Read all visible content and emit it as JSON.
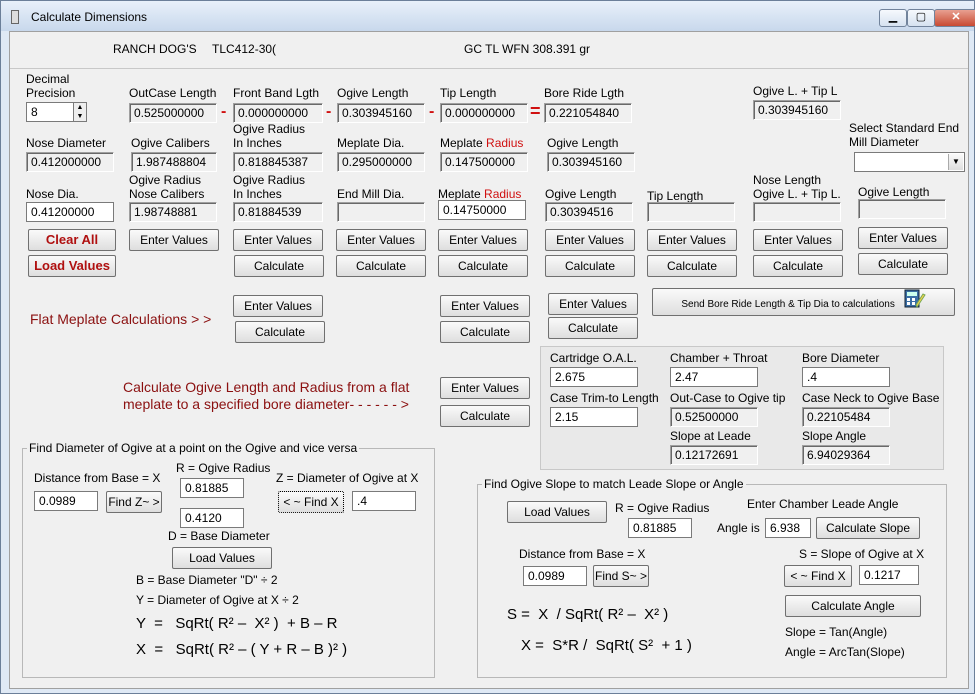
{
  "window": {
    "title": "Calculate Dimensions",
    "min": "▁",
    "max": "▢",
    "close": "✕"
  },
  "header": {
    "cartridge": "RANCH DOG'S",
    "bullet": "TLC412-30(",
    "weight": "GC TL WFN  308.391 gr"
  },
  "precision": {
    "label1": "Decimal",
    "label2": "Precision",
    "value": "8"
  },
  "row1": {
    "outcase_label": "OutCase Length",
    "outcase_value": "0.525000000",
    "frontband_label": "Front Band Lgth",
    "frontband_value": "0.000000000",
    "ogive_label": "Ogive Length",
    "ogive_value": "0.303945160",
    "tip_label": "Tip Length",
    "tip_value": "0.000000000",
    "boreride_label": "Bore Ride Lgth",
    "boreride_value": "0.221054840",
    "ogivetip_label": "Ogive L. + Tip L",
    "ogivetip_value": "0.303945160",
    "minus": "-",
    "equals": "="
  },
  "row2": {
    "nose_label": "Nose Diameter",
    "nose_value": "0.412000000",
    "calibers_label": "Ogive Calibers",
    "calibers_value": "1.987488804",
    "radius_label1": "Ogive Radius",
    "radius_label2": "In Inches",
    "radius_value": "0.818845387",
    "meplate_label": "Meplate Dia.",
    "meplate_value": "0.295000000",
    "mepradius_label": "Meplate",
    "mepradius_red": "Radius",
    "mepradius_value": "0.147500000",
    "ogivelen_label": "Ogive Length",
    "ogivelen_value": "0.303945160",
    "endmill_label1": "Select Standard End",
    "endmill_label2": "Mill Diameter"
  },
  "row3": {
    "nosedia_label": "Nose Dia.",
    "nosedia_value": "0.41200000",
    "nosecal_label1": "Ogive Radius",
    "nosecal_label2": "Nose Calibers",
    "nosecal_value": "1.98748881",
    "radin_label1": "Ogive Radius",
    "radin_label2": "In Inches",
    "radin_value": "0.81884539",
    "endmill_label": "End Mill Dia.",
    "endmill_value": "",
    "mepradius_label": "Meplate",
    "mepradius_red": "Radius",
    "mepradius_value": "0.14750000",
    "ogivelen_label": "Ogive Length",
    "ogivelen_value": "0.30394516",
    "tiplen_label": "Tip Length",
    "tiplen_value": "",
    "nosetip_label1": "Nose Length",
    "nosetip_label2": "Ogive L. + Tip L.",
    "nosetip_value": "",
    "ogivelen2_label": "Ogive Length",
    "ogivelen2_value": ""
  },
  "buttons": {
    "clear_all": "Clear All",
    "load_values": "Load Values",
    "enter_values": "Enter Values",
    "calculate": "Calculate",
    "send": "Send Bore Ride Length & Tip Dia to calculations"
  },
  "flat": {
    "text": "Flat Meplate Calculations > >"
  },
  "ogive_calc": {
    "line1": "Calculate Ogive Length and Radius from  a flat",
    "line2": "meplate to a specified  bore diameter- - - - - - >"
  },
  "cartridge_panel": {
    "oal_label": "Cartridge O.A.L.",
    "oal_value": "2.675",
    "chamber_label": "Chamber + Throat",
    "chamber_value": "2.47",
    "bore_label": "Bore Diameter",
    "bore_value": ".4",
    "trim_label": "Case Trim-to Length",
    "trim_value": "2.15",
    "outcase_label": "Out-Case to Ogive tip",
    "outcase_value": "0.52500000",
    "neck_label": "Case Neck to Ogive Base",
    "neck_value": "0.22105484",
    "slope_label": "Slope at Leade",
    "slope_value": "0.12172691",
    "angle_label": "Slope Angle",
    "angle_value": "6.94029364"
  },
  "find_dia": {
    "title": "Find Diameter of Ogive at a point on the Ogive and vice versa",
    "dist_label": "Distance from Base = X",
    "dist_value": "0.0989",
    "findz": "Find Z~ >",
    "r_label": "R = Ogive Radius",
    "r_value": "0.81885",
    "z_label": "Z = Diameter of Ogive at X",
    "findx": "< ~ Find X",
    "z_value": ".4",
    "d_value": "0.4120",
    "d_label": "D = Base Diameter",
    "load": "Load Values",
    "b_text": "B = Base Diameter  \"D\"  ÷ 2",
    "y_text": "Y = Diameter of Ogive at X ÷ 2",
    "f1": "Y  =   SqRt( R² –  X² )  + B – R",
    "f2": "X  =   SqRt( R² – ( Y + R – B )² )"
  },
  "find_slope": {
    "title": "Find Ogive Slope to match Leade Slope or Angle",
    "load": "Load Values",
    "r_label": "R = Ogive Radius",
    "r_value": "0.81885",
    "angle_label1": "Enter Chamber Leade Angle",
    "angle_label2": "Angle is",
    "angle_value": "6.938",
    "calc_slope": "Calculate Slope",
    "dist_label": "Distance from Base = X",
    "dist_value": "0.0989",
    "finds": "Find S~ >",
    "s_label": "S = Slope of Ogive at X",
    "findx": "< ~ Find X",
    "s_value": "0.1217",
    "calc_angle": "Calculate Angle",
    "f1": "S =  X  / SqRt( R² –  X² )",
    "f2": "X =  S*R /  SqRt( S²  + 1 )",
    "slope_eq": "Slope = Tan(Angle)",
    "angle_eq": "Angle = ArcTan(Slope)"
  }
}
